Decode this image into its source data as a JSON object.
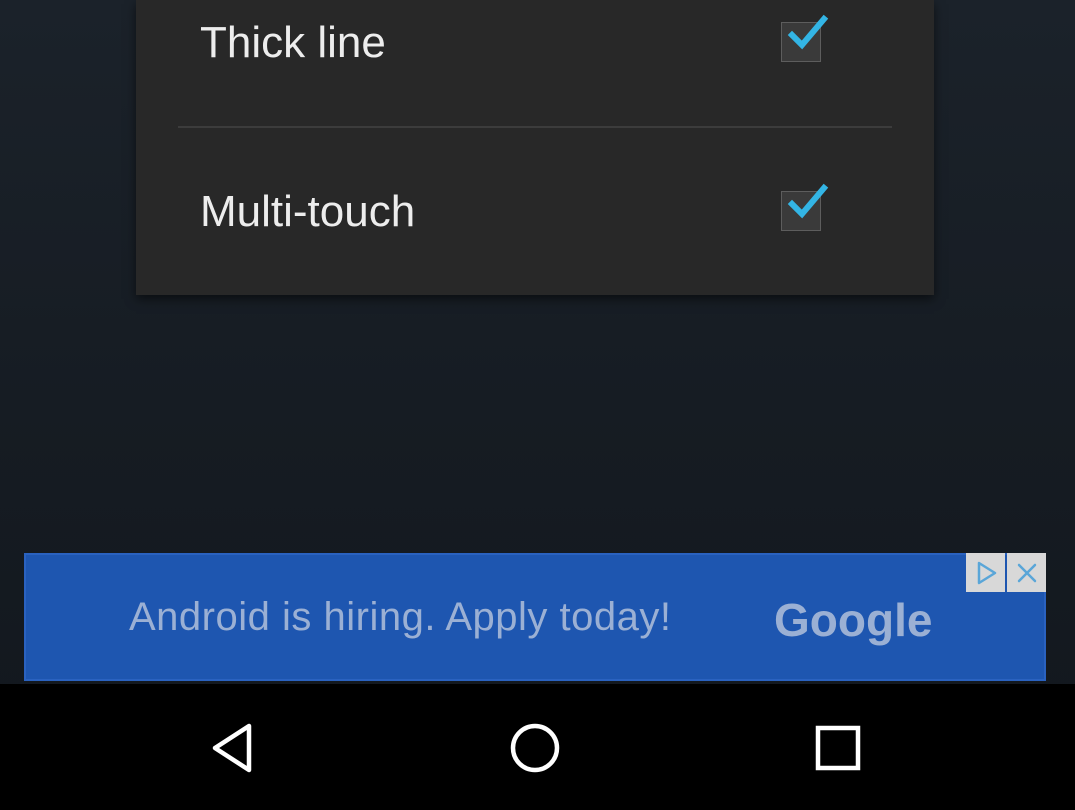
{
  "settings": {
    "items": [
      {
        "label": "Thick line",
        "checked": true
      },
      {
        "label": "Multi-touch",
        "checked": true
      }
    ]
  },
  "ad": {
    "text": "Android is hiring. Apply today!",
    "brand": "Google",
    "icons": [
      "adchoices-icon",
      "close-icon"
    ]
  },
  "navbar": {
    "icons": [
      "back-icon",
      "home-icon",
      "recents-icon"
    ]
  },
  "colors": {
    "dialog_bg": "#282828",
    "checkmark": "#33b5e5",
    "ad_bg": "#1e56b0",
    "navbar_bg": "#000000"
  }
}
